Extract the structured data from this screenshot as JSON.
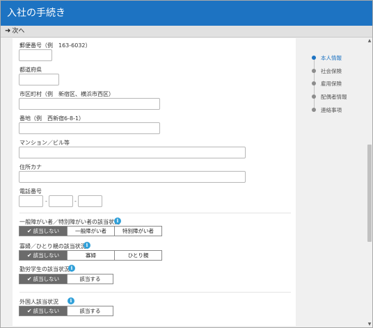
{
  "window": {
    "title": "入社の手続き"
  },
  "toolbar": {
    "next_label": "次へ"
  },
  "form": {
    "postal_label": "郵便番号（例　163-6032）",
    "prefecture_label": "都道府県",
    "city_label": "市区町村（例　新宿区、横浜市西区）",
    "street_label": "番地（例　西新宿6-8-1）",
    "building_label": "マンション／ビル等",
    "address_kana_label": "住所カナ",
    "phone_label": "電話番号",
    "phone_separator": "-",
    "disability": {
      "label": "一般障がい者／特別障がい者の該当状況",
      "options": [
        "該当しない",
        "一般障がい者",
        "特別障がい者"
      ],
      "selected": "該当しない"
    },
    "widow": {
      "label": "寡婦／ひとり親の該当状況",
      "options": [
        "該当しない",
        "寡婦",
        "ひとり親"
      ],
      "selected": "該当しない"
    },
    "working_student": {
      "label": "勤労学生の該当状況",
      "options": [
        "該当しない",
        "該当する"
      ],
      "selected": "該当しない"
    },
    "foreigner": {
      "label": "外国人該当状況",
      "options": [
        "該当しない",
        "該当する"
      ],
      "selected": "該当しない"
    }
  },
  "sidenav": {
    "items": [
      "本人情報",
      "社会保険",
      "雇用保険",
      "配偶者情報",
      "連絡事項"
    ],
    "active": "本人情報"
  },
  "colors": {
    "titlebar": "#1d73c2",
    "selected_segment": "#6b6b6b",
    "info_icon": "#2f9fd8"
  }
}
